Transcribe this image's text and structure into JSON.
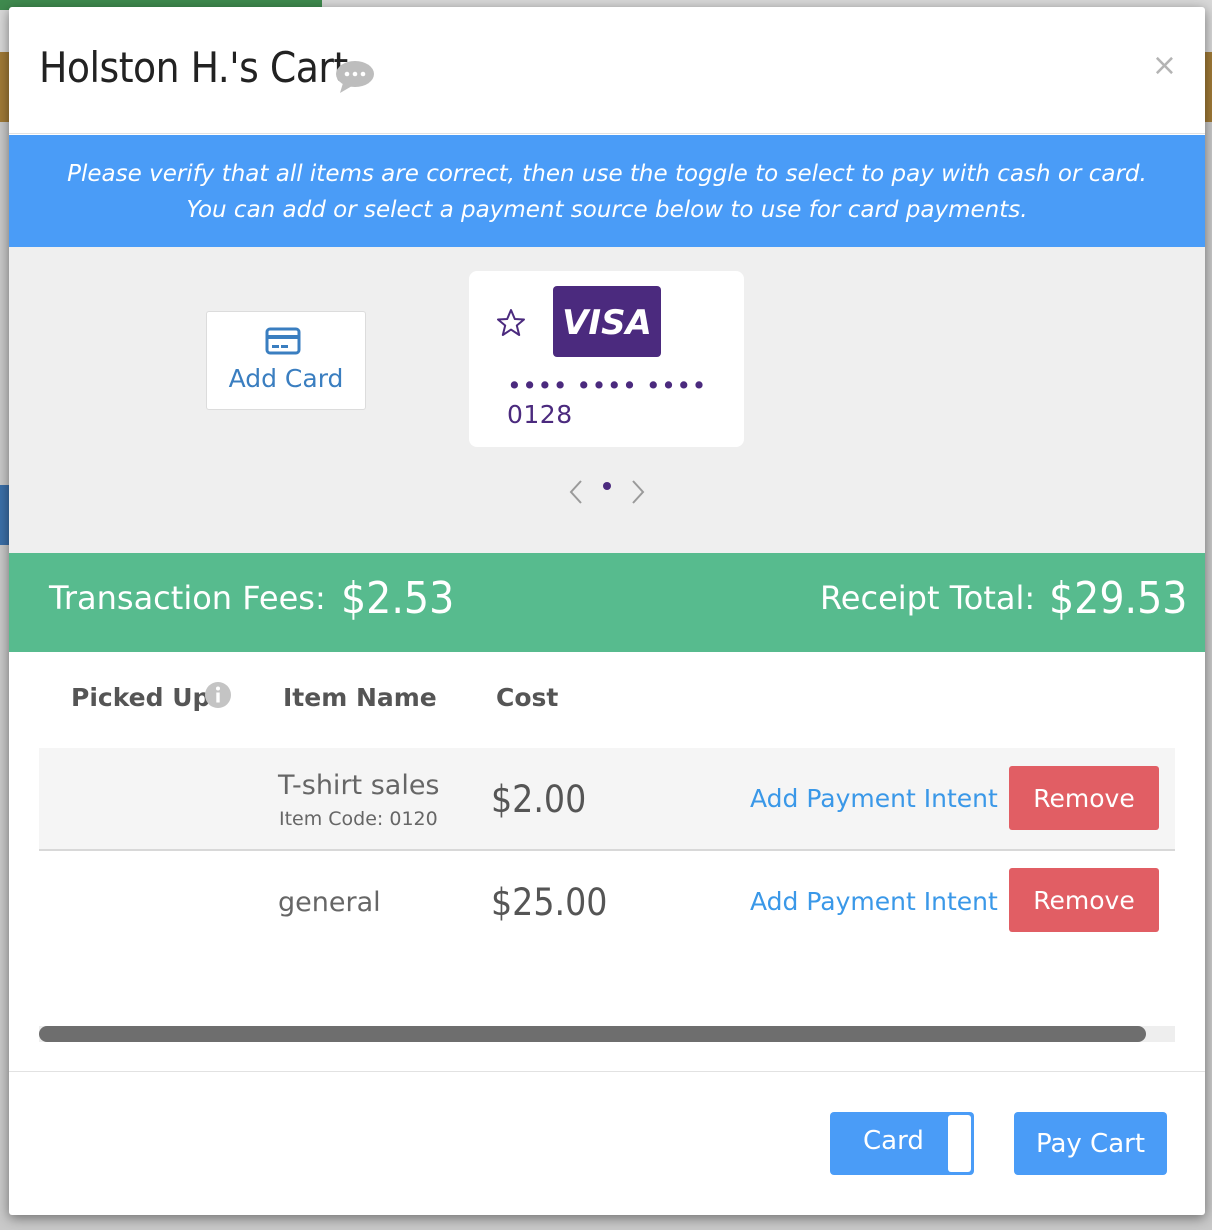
{
  "modal": {
    "title": "Holston H.'s Cart",
    "close_glyph": "×"
  },
  "banner": {
    "line1": "Please verify that all items are correct, then use the toggle to select to pay with cash or card.",
    "line2": "You can add or select a payment source below to use for card payments."
  },
  "payment_sources": {
    "add_card_label": "Add Card",
    "cards": [
      {
        "brand": "VISA",
        "number_masked": "•••• •••• •••• 0128",
        "favorite": false
      }
    ],
    "carousel": {
      "prev_icon": "chevron-left-icon",
      "next_icon": "chevron-right-icon",
      "pages": 1,
      "current": 1
    }
  },
  "totals": {
    "fees_label": "Transaction Fees:",
    "fees_value": "$2.53",
    "total_label": "Receipt Total:",
    "total_value": "$29.53"
  },
  "table": {
    "headers": [
      "Picked Up",
      "Item Name",
      "Cost"
    ],
    "rows": [
      {
        "name": "T-shirt sales",
        "code": "Item Code: 0120",
        "cost": "$2.00",
        "intent_label": "Add Payment Intent",
        "remove_label": "Remove"
      },
      {
        "name": "general",
        "code": "",
        "cost": "$25.00",
        "intent_label": "Add Payment Intent",
        "remove_label": "Remove"
      }
    ]
  },
  "footer": {
    "toggle_label": "Card",
    "pay_label": "Pay Cart"
  },
  "colors": {
    "banner_blue": "#4a9cf7",
    "totals_green": "#57bb8e",
    "visa_purple": "#4b2a7e",
    "remove_red": "#e15e64",
    "link_blue": "#3a98e8"
  }
}
